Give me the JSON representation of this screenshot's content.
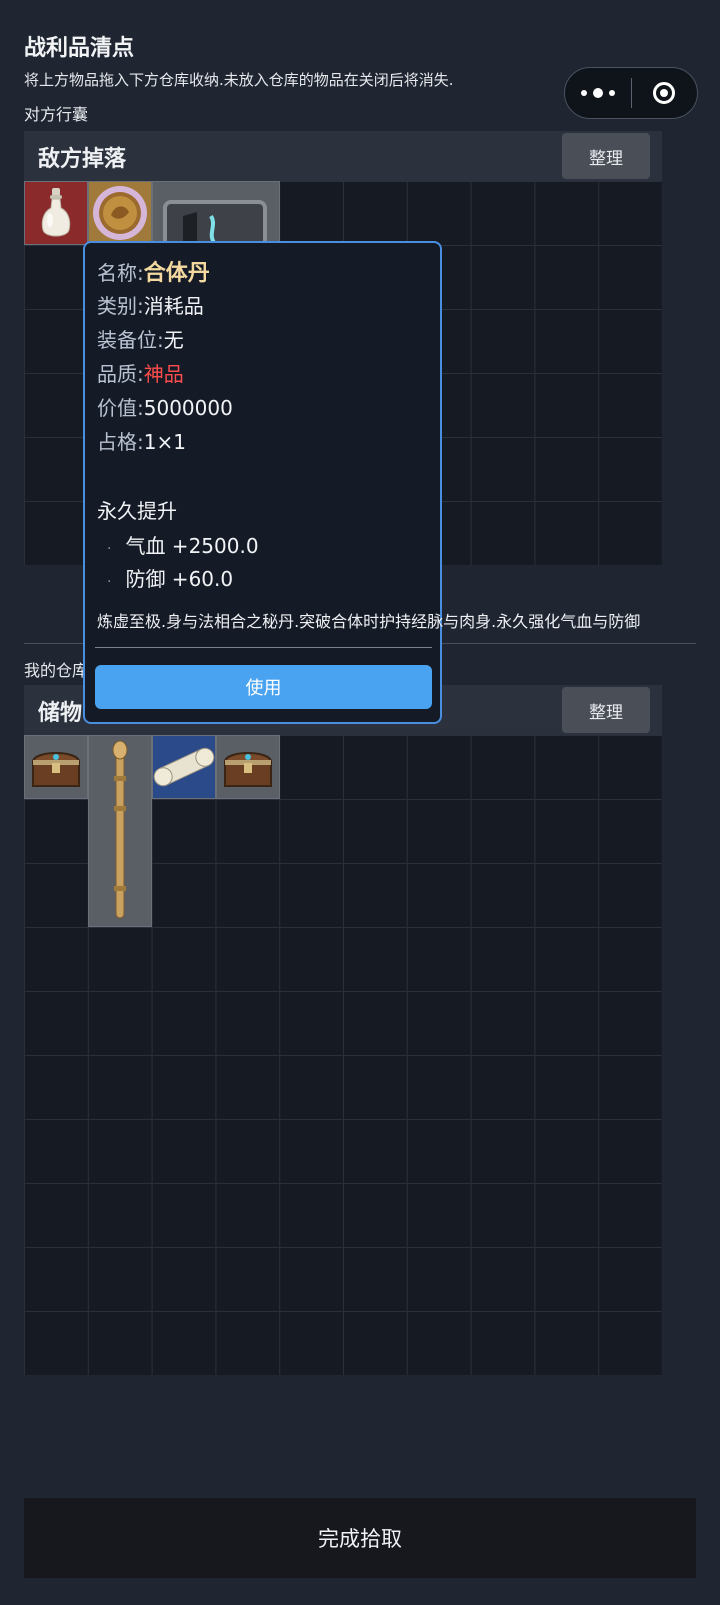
{
  "header": {
    "title": "战利品清点",
    "notice": "将上方物品拖入下方仓库收纳.未放入仓库的物品在关闭后将消失.",
    "enemy_section": "对方行囊"
  },
  "capsule": {
    "more_icon": "more-dots-icon",
    "close_icon": "target-close-icon"
  },
  "enemy_panel": {
    "title": "敌方掉落",
    "sort_label": "整理",
    "items": [
      {
        "name": "white-porcelain-vial-icon",
        "bg": "#8a2a2a"
      },
      {
        "name": "gold-coin-token-icon",
        "bg": "#a07a3a"
      },
      {
        "name": "stone-tablet-icon",
        "bg": "#5a5f66"
      }
    ]
  },
  "tooltip": {
    "name_label": "名称:",
    "name_value": "合体丹",
    "type_label": "类别:",
    "type_value": "消耗品",
    "slot_label": "装备位:",
    "slot_value": "无",
    "quality_label": "品质:",
    "quality_value": "神品",
    "value_label": "价值:",
    "value_value": "5000000",
    "size_label": "占格:",
    "size_value": "1×1",
    "bonus_heading": "永久提升",
    "bonuses": [
      "气血 +2500.0",
      "防御 +60.0"
    ],
    "description": "炼虚至极.身与法相合之秘丹.突破合体时护持经脉与肉身.永久强化气血与防御",
    "use_label": "使用"
  },
  "my_section": "我的仓库",
  "storage_panel": {
    "title": "储物",
    "sort_label": "整理",
    "items": [
      {
        "name": "treasure-chest-icon",
        "bg": "#5a5f66"
      },
      {
        "name": "golden-staff-icon",
        "bg": "#5a5f66"
      },
      {
        "name": "scroll-icon",
        "bg": "#2a4a8a"
      },
      {
        "name": "treasure-chest-icon",
        "bg": "#5a5f66"
      }
    ]
  },
  "footer": {
    "finish_label": "完成拾取"
  },
  "colors": {
    "accent": "#4aa3f0",
    "quality_divine": "#ff4c4c",
    "tooltip_border": "#4a8ee0"
  }
}
